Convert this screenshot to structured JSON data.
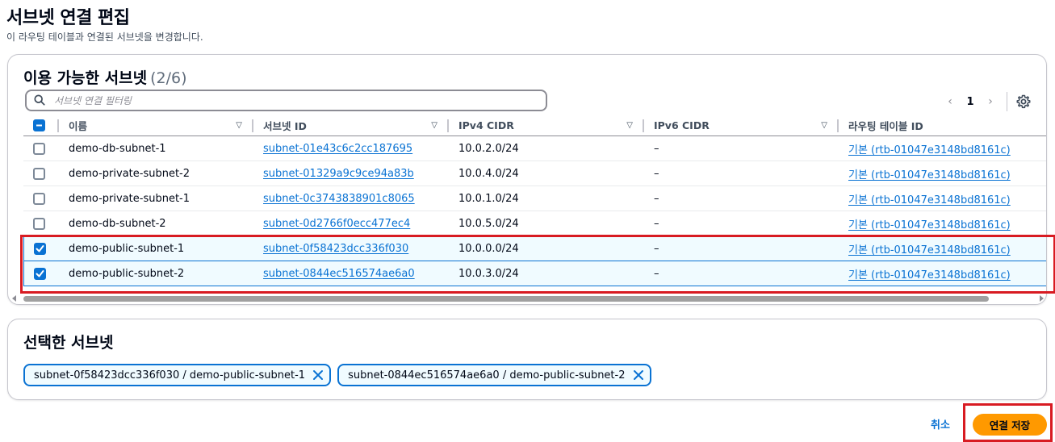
{
  "page": {
    "title": "서브넷 연결 편집",
    "description": "이 라우팅 테이블과 연결된 서브넷을 변경합니다."
  },
  "available": {
    "title": "이용 가능한 서브넷",
    "count": "(2/6)",
    "filter_placeholder": "서브넷 연결 필터링",
    "page_number": "1",
    "columns": [
      "이름",
      "서브넷 ID",
      "IPv4 CIDR",
      "IPv6 CIDR",
      "라우팅 테이블 ID"
    ],
    "rows": [
      {
        "name": "demo-db-subnet-1",
        "subnet_id": "subnet-01e43c6c2cc187695",
        "ipv4": "10.0.2.0/24",
        "ipv6": "–",
        "route_table": "기본 (rtb-01047e3148bd8161c)",
        "checked": false
      },
      {
        "name": "demo-private-subnet-2",
        "subnet_id": "subnet-01329a9c9ce94a83b",
        "ipv4": "10.0.4.0/24",
        "ipv6": "–",
        "route_table": "기본 (rtb-01047e3148bd8161c)",
        "checked": false
      },
      {
        "name": "demo-private-subnet-1",
        "subnet_id": "subnet-0c3743838901c8065",
        "ipv4": "10.0.1.0/24",
        "ipv6": "–",
        "route_table": "기본 (rtb-01047e3148bd8161c)",
        "checked": false
      },
      {
        "name": "demo-db-subnet-2",
        "subnet_id": "subnet-0d2766f0ecc477ec4",
        "ipv4": "10.0.5.0/24",
        "ipv6": "–",
        "route_table": "기본 (rtb-01047e3148bd8161c)",
        "checked": false
      },
      {
        "name": "demo-public-subnet-1",
        "subnet_id": "subnet-0f58423dcc336f030",
        "ipv4": "10.0.0.0/24",
        "ipv6": "–",
        "route_table": "기본 (rtb-01047e3148bd8161c)",
        "checked": true
      },
      {
        "name": "demo-public-subnet-2",
        "subnet_id": "subnet-0844ec516574ae6a0",
        "ipv4": "10.0.3.0/24",
        "ipv6": "–",
        "route_table": "기본 (rtb-01047e3148bd8161c)",
        "checked": true
      }
    ]
  },
  "selected": {
    "title": "선택한 서브넷",
    "tokens": [
      "subnet-0f58423dcc336f030 / demo-public-subnet-1",
      "subnet-0844ec516574ae6a0 / demo-public-subnet-2"
    ]
  },
  "actions": {
    "cancel": "취소",
    "save": "연결 저장"
  },
  "colors": {
    "accent": "#0972d3",
    "primary_button": "#ff9900",
    "highlight": "#d81b22"
  }
}
